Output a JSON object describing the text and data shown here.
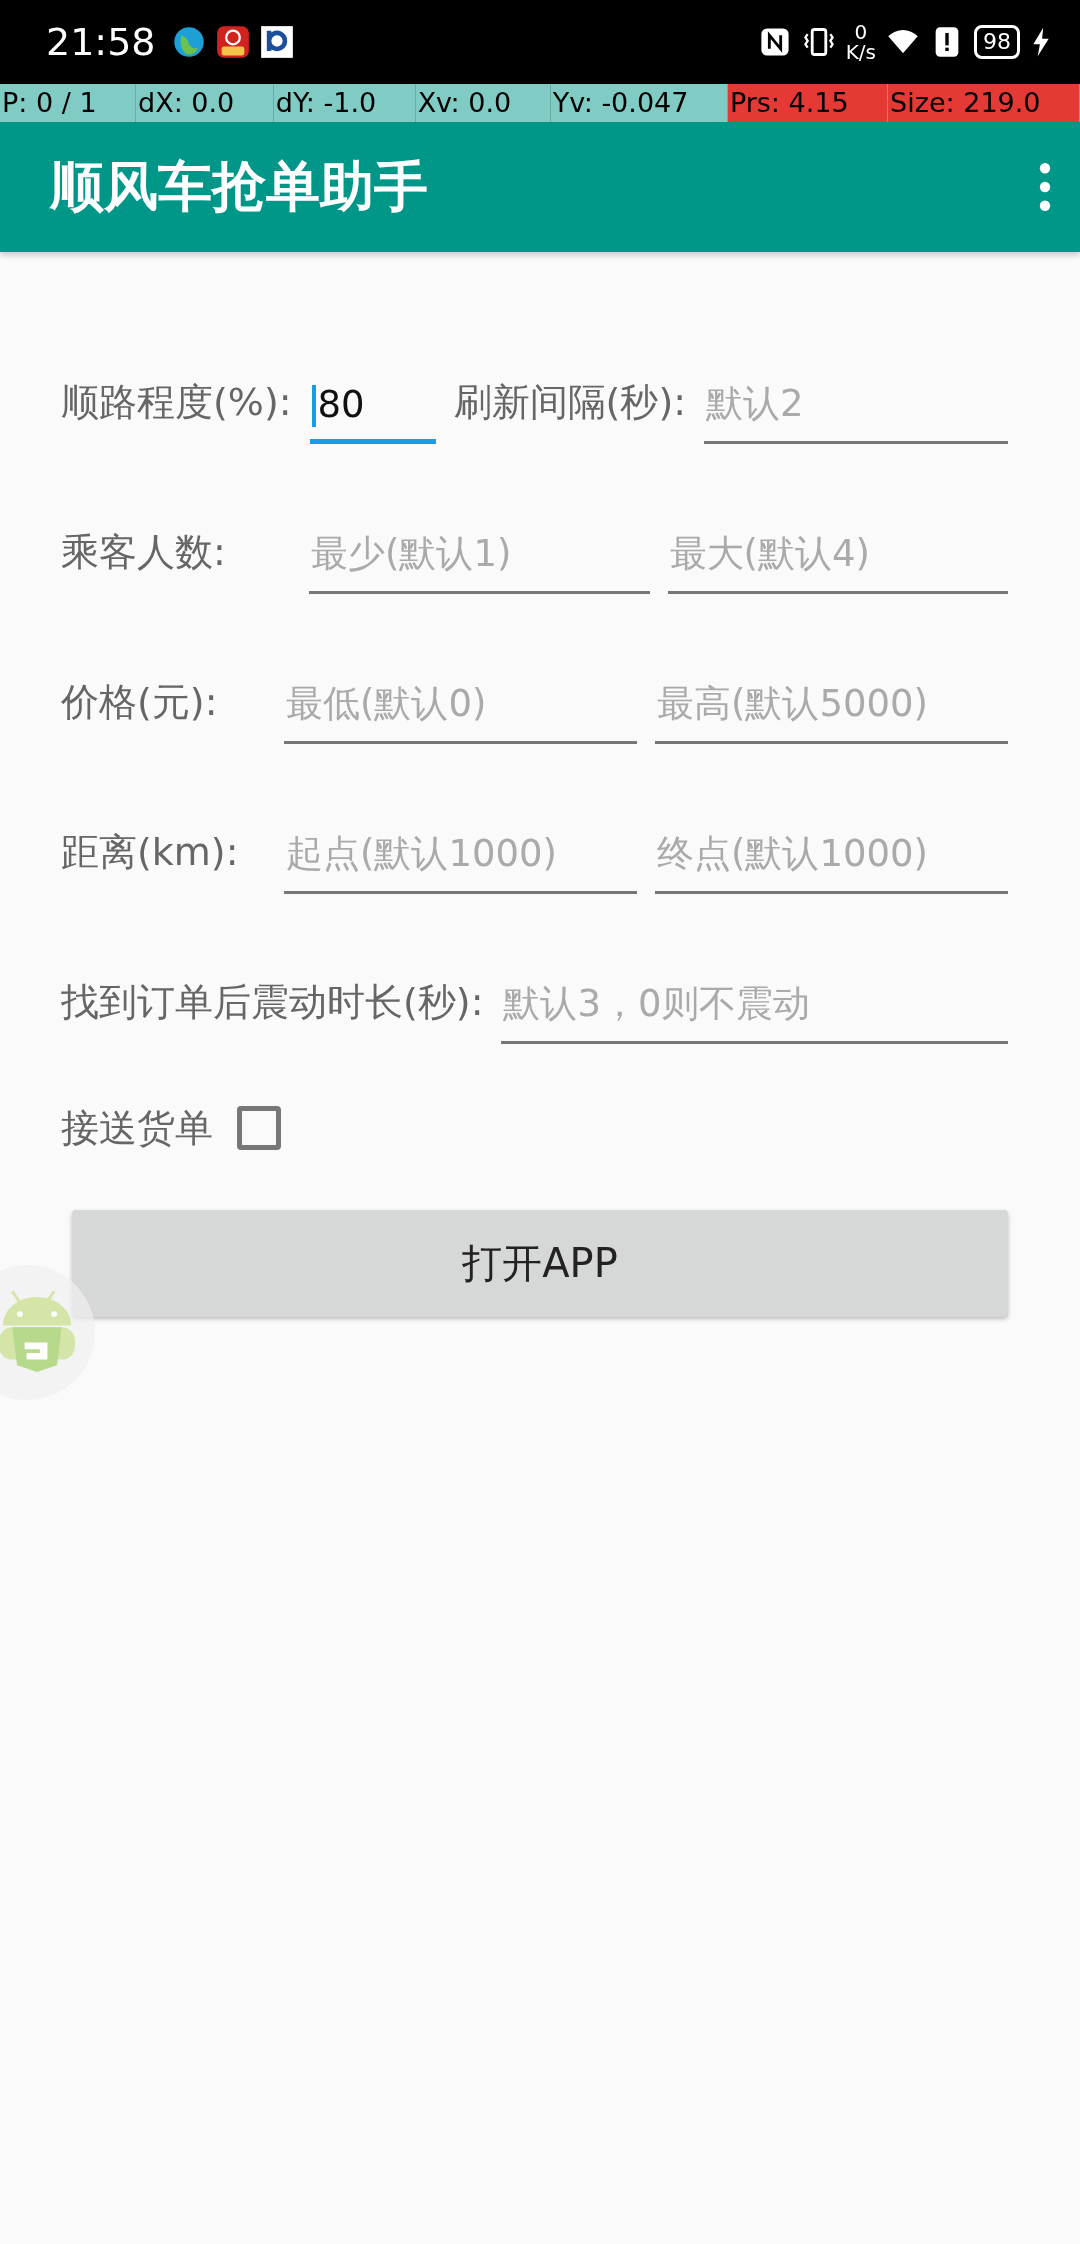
{
  "status_bar": {
    "time": "21:58",
    "net_speed": "0",
    "net_unit": "K/s",
    "battery": "98"
  },
  "pointer_bar": [
    {
      "text": "P: 0 / 1",
      "kind": "normal"
    },
    {
      "text": "dX: 0.0",
      "kind": "normal"
    },
    {
      "text": "dY: -1.0",
      "kind": "normal"
    },
    {
      "text": "Xv: 0.0",
      "kind": "normal"
    },
    {
      "text": "Yv: -0.047",
      "kind": "normal"
    },
    {
      "text": "Prs: 4.15",
      "kind": "alert"
    },
    {
      "text": "Size: 219.0",
      "kind": "alert"
    }
  ],
  "app_bar": {
    "title": "顺风车抢单助手"
  },
  "form": [
    {
      "items": [
        {
          "kind": "label",
          "text": "顺路程度(%):"
        },
        {
          "kind": "input",
          "value": "80",
          "focused": true
        },
        {
          "kind": "label",
          "text": "刷新间隔(秒):"
        },
        {
          "kind": "input",
          "placeholder": "默认2",
          "focused": false
        }
      ]
    },
    {
      "items": [
        {
          "kind": "label",
          "text": "乘客人数:"
        },
        {
          "kind": "input",
          "placeholder": "最少(默认1)",
          "focused": false
        },
        {
          "kind": "input",
          "placeholder": "最大(默认4)",
          "focused": false
        }
      ]
    },
    {
      "items": [
        {
          "kind": "label",
          "text": "价格(元):"
        },
        {
          "kind": "input",
          "placeholder": "最低(默认0)",
          "focused": false
        },
        {
          "kind": "input",
          "placeholder": "最高(默认5000)",
          "focused": false
        }
      ]
    },
    {
      "items": [
        {
          "kind": "label",
          "text": "距离(km):"
        },
        {
          "kind": "input",
          "placeholder": "起点(默认1000)",
          "focused": false
        },
        {
          "kind": "input",
          "placeholder": "终点(默认1000)",
          "focused": false
        }
      ]
    },
    {
      "items": [
        {
          "kind": "label",
          "text": "找到订单后震动时长(秒):"
        },
        {
          "kind": "input",
          "placeholder": "默认3，0则不震动",
          "focused": false
        }
      ]
    },
    {
      "items": [
        {
          "kind": "label",
          "text": "接送货单"
        },
        {
          "kind": "checkbox",
          "checked": false
        }
      ]
    }
  ],
  "button": {
    "label": "打开APP"
  }
}
